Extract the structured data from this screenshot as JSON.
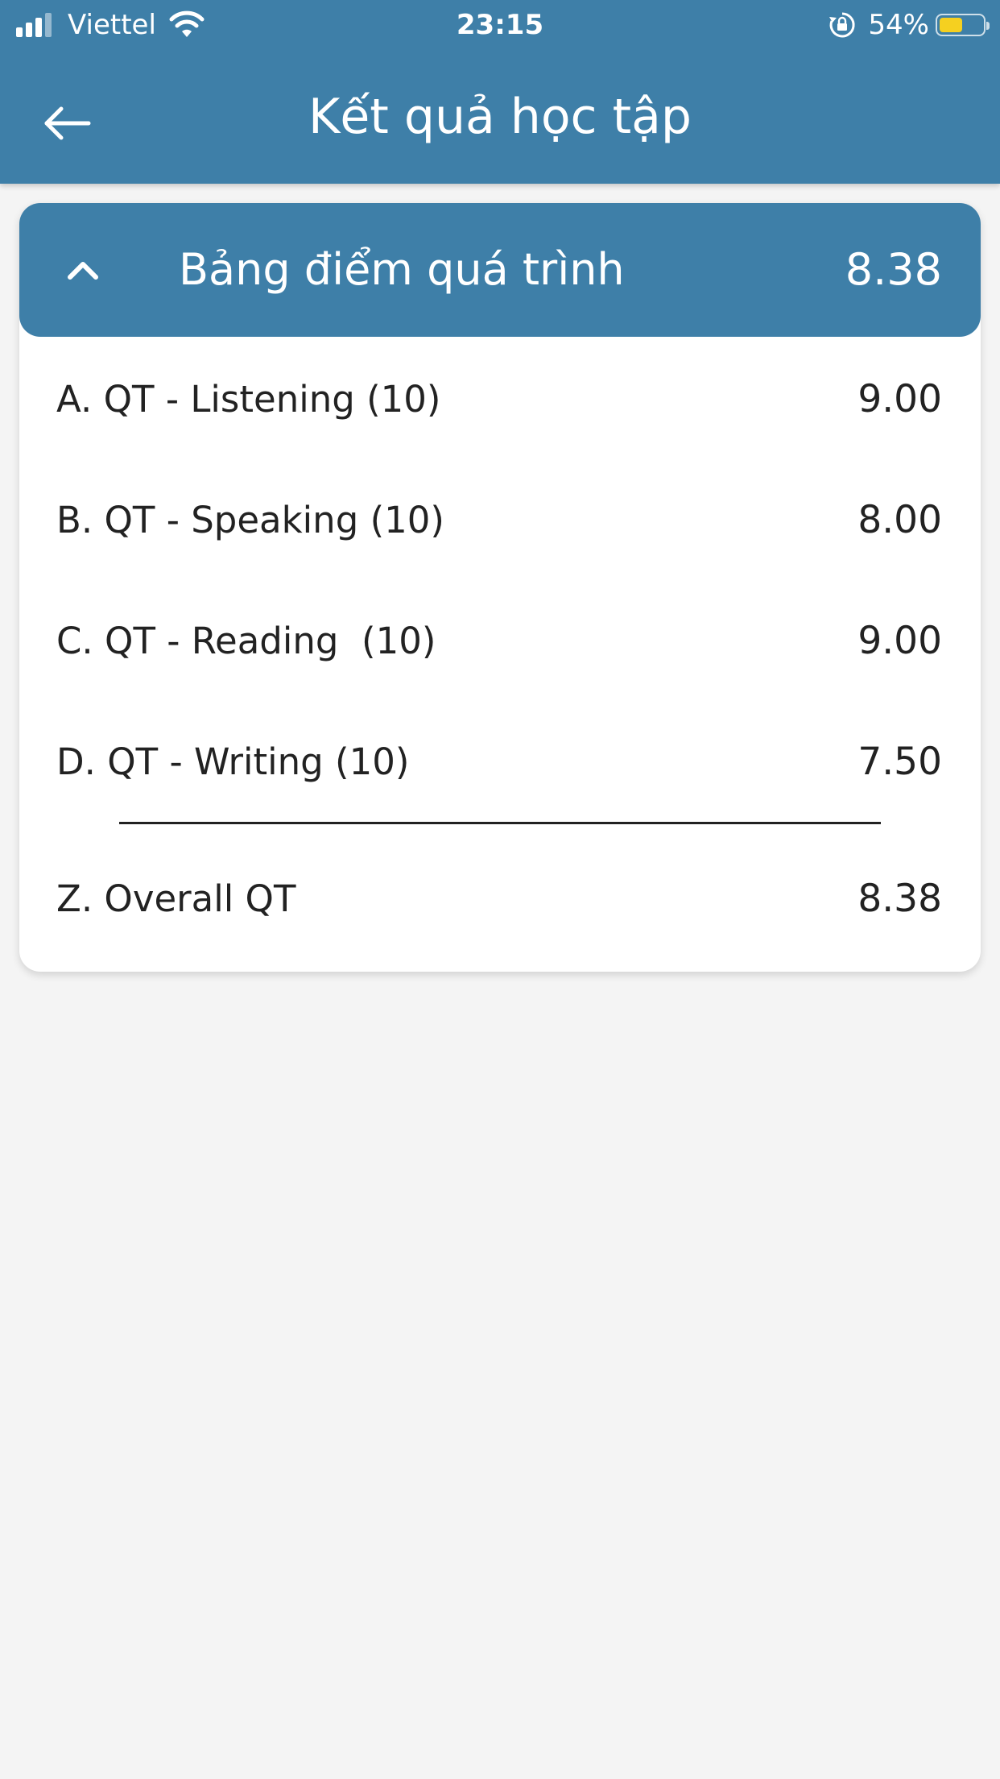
{
  "status_bar": {
    "carrier": "Viettel",
    "time": "23:15",
    "battery_percent": "54%",
    "battery_level": 0.54,
    "icons": [
      "signal-icon",
      "wifi-icon",
      "rotation-lock-icon",
      "battery-icon"
    ]
  },
  "header": {
    "title": "Kết quả học tập",
    "back_icon": "arrow-left-icon"
  },
  "score_card": {
    "title": "Bảng điểm quá trình",
    "total": "8.38",
    "collapse_icon": "chevron-up-icon",
    "rows": [
      {
        "label": "A. QT - Listening (10)",
        "value": "9.00"
      },
      {
        "label": "B. QT - Speaking (10)",
        "value": "8.00"
      },
      {
        "label": "C. QT - Reading  (10)",
        "value": "9.00"
      },
      {
        "label": "D. QT - Writing (10)",
        "value": "7.50"
      }
    ],
    "overall": {
      "label": "Z. Overall QT",
      "value": "8.38"
    }
  },
  "colors": {
    "primary": "#3e7fa8",
    "background": "#f4f4f4",
    "card": "#ffffff",
    "text": "#222222",
    "battery": "#f5d020"
  }
}
